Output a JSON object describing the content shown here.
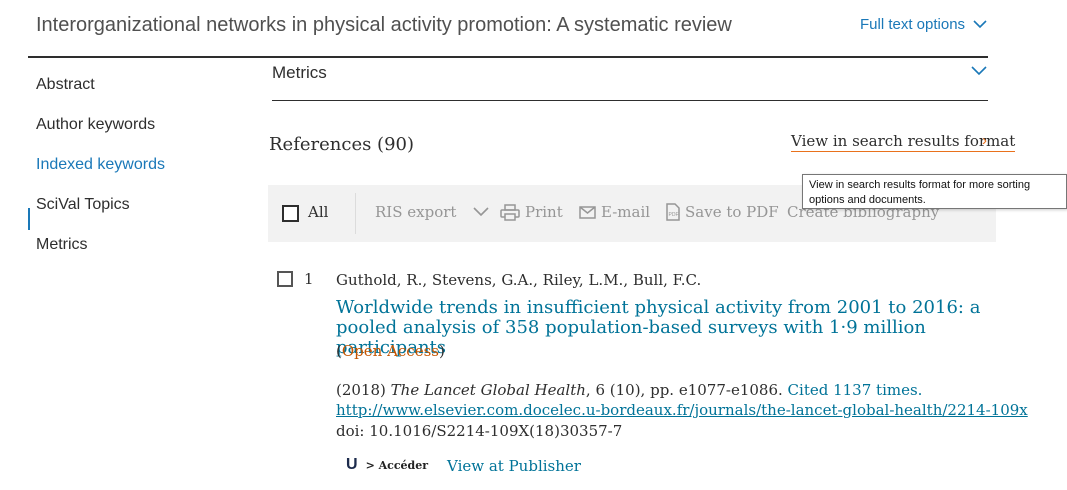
{
  "header": {
    "title": "Interorganizational networks in physical activity promotion: A systematic review",
    "full_text_options": "Full text options"
  },
  "sidebar": {
    "items": [
      {
        "label": "Abstract"
      },
      {
        "label": "Author keywords"
      },
      {
        "label": "Indexed keywords"
      },
      {
        "label": "SciVal Topics"
      },
      {
        "label": "Metrics"
      }
    ]
  },
  "metrics": {
    "heading": "Metrics"
  },
  "references": {
    "heading": "References (90)",
    "view_results_label": "View in search results format",
    "view_results_arrow": "›",
    "tooltip": "View in search results format for more sorting options and documents.",
    "toolbar": {
      "all": "All",
      "ris_export": "RIS export",
      "print": "Print",
      "email": "E-mail",
      "save_pdf": "Save to PDF",
      "create_bibliography": "Create bibliography"
    },
    "entries": [
      {
        "number": "1",
        "authors": "Guthold, R., Stevens, G.A., Riley, L.M., Bull, F.C.",
        "title": "Worldwide trends in insufficient physical activity from 2001 to 2016: a pooled analysis of 358 population-based surveys with 1·9 million participants",
        "open_access_prefix": "(",
        "open_access": "Open Access",
        "open_access_suffix": ")",
        "year": "(2018) ",
        "journal": "The Lancet Global Health",
        "volume_pages": ", 6 (10), pp. e1077-e1086. ",
        "cited": "Cited 1137 times.",
        "url": "http://www.elsevier.com.docelec.u-bordeaux.fr/journals/the-lancet-global-health/2214-109x",
        "doi": "doi: 10.1016/S2214-109X(18)30357-7",
        "acceder_logo": "U",
        "acceder_label": "> Accéder",
        "view_publisher": "View at Publisher"
      }
    ]
  },
  "colors": {
    "link": "#007398",
    "active_nav": "#1a78b8",
    "accent_orange": "#e9711c",
    "open_access": "#c45500"
  }
}
